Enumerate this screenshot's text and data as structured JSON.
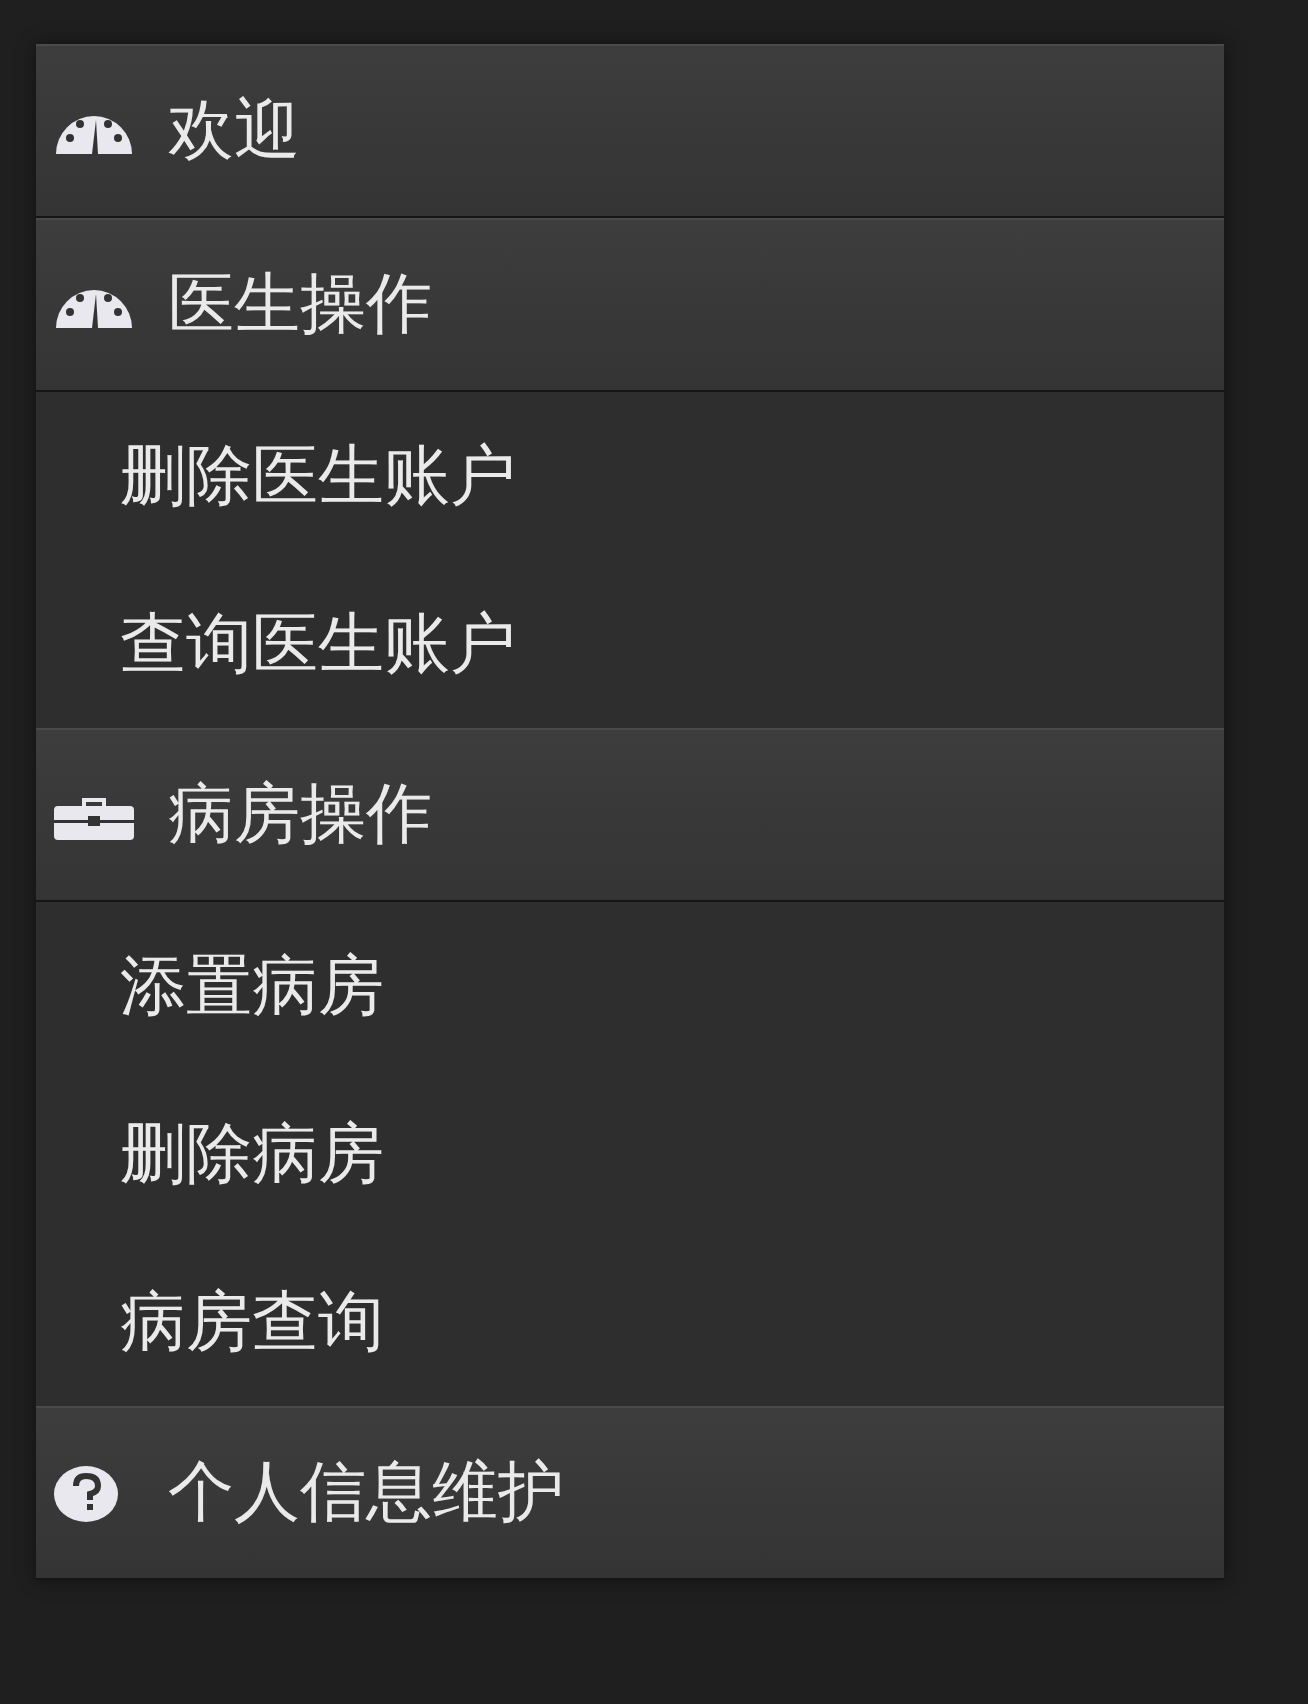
{
  "menu": {
    "sections": [
      {
        "label": "欢迎"
      },
      {
        "label": "医生操作",
        "items": [
          "删除医生账户",
          "查询医生账户"
        ]
      },
      {
        "label": "病房操作",
        "items": [
          "添置病房",
          "删除病房",
          "病房查询"
        ]
      },
      {
        "label": "个人信息维护"
      }
    ]
  }
}
